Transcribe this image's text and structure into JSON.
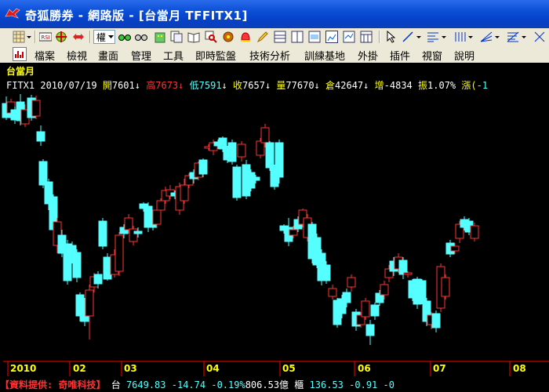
{
  "window": {
    "title": "奇狐勝券 - 網路版 - [台當月 TFFITX1]"
  },
  "toolbar": {
    "icons": [
      "grid-icon",
      "dropdown-arrow-icon",
      "rsi-icon",
      "crosshair-icon",
      "arrows-icon",
      "weight-dropdown",
      "glasses-icon",
      "glasses-2-icon",
      "building-icon",
      "copy-icon",
      "book-icon",
      "search-icon",
      "gear-icon",
      "alarm-icon",
      "pencil-icon",
      "layout-1-icon",
      "layout-2-icon",
      "layout-3-icon",
      "layout-4-icon",
      "layout-5-icon",
      "layout-6-icon",
      "pointer-icon",
      "line-icon",
      "hlines-icon",
      "vlines-icon",
      "fan-icon",
      "fib-icon",
      "cross-icon"
    ],
    "weight_label": "權"
  },
  "menu": {
    "items": [
      "檔案",
      "檢視",
      "畫面",
      "管理",
      "工具",
      "即時監盤",
      "技術分析",
      "訓練基地",
      "外掛",
      "插件",
      "視窗",
      "說明"
    ]
  },
  "chart": {
    "name": "台當月",
    "symbol": "FITX1",
    "date": "2010/07/19",
    "open_label": "開",
    "open": "7601",
    "high_label": "高",
    "high": "7673",
    "low_label": "低",
    "low": "7591",
    "close_label": "收",
    "close": "7657",
    "volume_label": "量",
    "volume": "77670",
    "oi_label": "倉",
    "oi": "42647",
    "inc_label": "增",
    "inc": "-4834",
    "amp_label": "振",
    "amp": "1.07%",
    "chg_label": "漲(",
    "chg": "-1",
    "arrow": "↓",
    "colors": {
      "up": "#ff3333",
      "down": "#55ffff",
      "text": "#ffffff",
      "label": "#ffff00"
    }
  },
  "xaxis": {
    "labels": [
      "2010",
      "02",
      "03",
      "04",
      "05",
      "06",
      "07",
      "08"
    ]
  },
  "status": {
    "provider": "【資料提供: 奇唯科技】",
    "index_name": "台",
    "index_value": "7649.83",
    "index_change": "-14.74",
    "index_pct": "-0.19%",
    "index_volume": "806.53億",
    "sector_name": "櫃",
    "sector_value": "136.53",
    "sector_change": "-0.91",
    "sector_pct": "-0"
  }
}
